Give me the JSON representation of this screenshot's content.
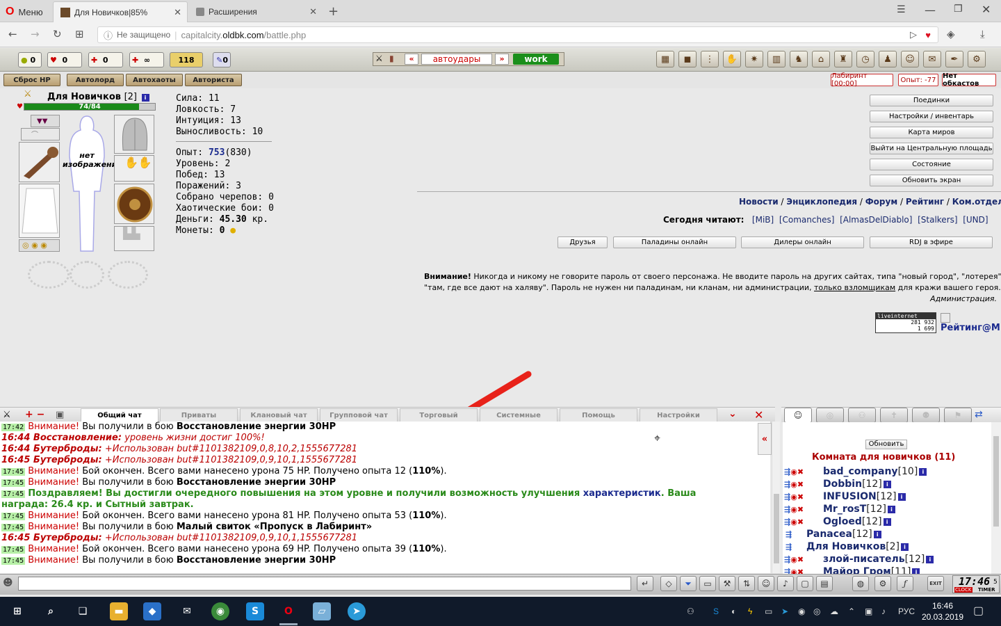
{
  "browser": {
    "menu_label": "Меню",
    "tabs": [
      {
        "title": "Для Новичков|85%"
      },
      {
        "title": "Расширения"
      }
    ],
    "security": "Не защищено",
    "url_prefix": "capitalcity.",
    "url_domain": "oldbk.com",
    "url_path": "/battle.php"
  },
  "topbar": {
    "counters": [
      "0",
      "0",
      "0",
      "∞",
      "118",
      "0"
    ],
    "autohits_label": "автоудары",
    "nav_left": "«",
    "nav_right": "»",
    "work_label": "work",
    "buttons": [
      "Сброс HP",
      "Автолорд",
      "Автохаоты",
      "Авториста"
    ],
    "labyrinth": "Лабиринт [00:00]",
    "exp_box": "Опыт: -77",
    "no_blocks": "Нет обкастов"
  },
  "character": {
    "name": "Для Новичков",
    "level": "[2]",
    "hp": "74/84",
    "hp_fraction": 0.88,
    "no_image": "нет изображения",
    "stats": [
      {
        "label": "Сила:",
        "value": "11"
      },
      {
        "label": "Ловкость:",
        "value": "7"
      },
      {
        "label": "Интуиция:",
        "value": "13"
      },
      {
        "label": "Выносливость:",
        "value": "10"
      }
    ],
    "exp_label": "Опыт:",
    "exp_value": "753",
    "exp_next": "(830)",
    "details": [
      {
        "label": "Уровень:",
        "value": "2"
      },
      {
        "label": "Побед:",
        "value": "13"
      },
      {
        "label": "Поражений:",
        "value": "3"
      },
      {
        "label": "Собрано черепов:",
        "value": "0"
      },
      {
        "label": "Хаотические бои:",
        "value": "0"
      }
    ],
    "money_label": "Деньги:",
    "money_value": "45.30",
    "money_unit": "кр.",
    "coins_label": "Монеты:",
    "coins_value": "0"
  },
  "right_menu": [
    {
      "label": "Поединки",
      "bold": true
    },
    {
      "label": "Настройки / инвентарь",
      "bold": false
    },
    {
      "label": "Карта миров",
      "bold": true
    },
    {
      "label": "Выйти на Центральную площадь",
      "bold": false
    },
    {
      "label": "Состояние",
      "bold": false
    },
    {
      "label": "Обновить экран",
      "bold": false
    }
  ],
  "links": [
    "Новости",
    "Энциклопедия",
    "Форум",
    "Рейтинг",
    "Ком.отдел"
  ],
  "reading": {
    "label": "Сегодня читают:",
    "clans": [
      "[MiB]",
      "[Comanches]",
      "[AlmasDelDiablo]",
      "[Stalkers]",
      "[UND]"
    ]
  },
  "mid_buttons": [
    "Друзья",
    "Паладины онлайн",
    "Дилеры онлайн",
    "RDJ в эфире"
  ],
  "warning": {
    "title": "Внимание!",
    "line1": "Никогда и никому не говорите пароль от своего персонажа. Не вводите пароль на других сайтах, типа \"новый город\", \"лотерея\",",
    "line2a": "\"там, где все дают на халяву\". Пароль не нужен ни паладинам, ни кланам, ни администрации,",
    "line2link": "только взломщикам",
    "line2b": "для кражи вашего героя.",
    "sign": "Администрация."
  },
  "counter": {
    "brand": "liveinternet",
    "n1": "281 932",
    "n2": "1 699",
    "rating_text": "Рейтинг@M"
  },
  "chat": {
    "tabs": [
      "Общий чат",
      "Приваты",
      "Клановый чат",
      "Групповой чат",
      "Торговый",
      "Системные",
      "Помощь",
      "Настройки"
    ],
    "collapse": "«",
    "lines": [
      {
        "ts": "17:42",
        "kind": "warn",
        "a": "Внимание!",
        "b": " Вы получили в бою ",
        "c": "Восстановление энергии 30HP",
        "d": ""
      },
      {
        "ts": "",
        "kind": "itb",
        "a": "16:44 Восстановление:",
        "b": " уровень жизни достиг 100%!",
        "c": "",
        "d": ""
      },
      {
        "ts": "",
        "kind": "itb",
        "a": "16:44 Бутерброды:",
        "b": " +Использован but#1101382109,0,8,10,2,1555677281",
        "c": "",
        "d": ""
      },
      {
        "ts": "",
        "kind": "itb",
        "a": "16:45 Бутерброды:",
        "b": " +Использован but#1101382109,0,9,10,1,1555677281",
        "c": "",
        "d": ""
      },
      {
        "ts": "17:45",
        "kind": "warn",
        "a": "Внимание!",
        "b": " Бой окончен. Всего вами нанесено урона 75 HP. Получено опыта 12 (",
        "c": "110%",
        "d": ")."
      },
      {
        "ts": "17:45",
        "kind": "warn",
        "a": "Внимание!",
        "b": " Вы получили в бою ",
        "c": "Восстановление энергии 30HP",
        "d": ""
      },
      {
        "ts": "17:45",
        "kind": "green",
        "a": "Поздравляем! Вы достигли очередного повышения на этом уровне и получили возможность улучшения",
        "b": " характеристик",
        "c": ". Ваша",
        "d": ""
      },
      {
        "ts": "",
        "kind": "green2",
        "a": "награда: 26.4 кр. и Сытный завтрак.",
        "b": "",
        "c": "",
        "d": ""
      },
      {
        "ts": "17:45",
        "kind": "warn",
        "a": "Внимание!",
        "b": " Бой окончен. Всего вами нанесено урона 81 HP. Получено опыта 53 (",
        "c": "110%",
        "d": ")."
      },
      {
        "ts": "17:45",
        "kind": "warn",
        "a": "Внимание!",
        "b": " Вы получили в бою ",
        "c": "Малый свиток «Пропуск в Лабиринт»",
        "d": ""
      },
      {
        "ts": "",
        "kind": "itb",
        "a": "16:45 Бутерброды:",
        "b": " +Использован but#1101382109,0,9,10,1,1555677281",
        "c": "",
        "d": ""
      },
      {
        "ts": "17:45",
        "kind": "warn",
        "a": "Внимание!",
        "b": " Бой окончен. Всего вами нанесено урона 69 HP. Получено опыта 39 (",
        "c": "110%",
        "d": ")."
      },
      {
        "ts": "17:45",
        "kind": "warn",
        "a": "Внимание!",
        "b": " Вы получили в бою ",
        "c": "Восстановление энергии 30HP",
        "d": ""
      }
    ]
  },
  "users_panel": {
    "refresh": "Обновить",
    "room": "Комната для новичков (11)",
    "users": [
      {
        "name": "bad_company",
        "level": "[10]"
      },
      {
        "name": "Dobbin",
        "level": "[12]"
      },
      {
        "name": "INFUSION",
        "level": "[12]"
      },
      {
        "name": "Mr_rosT",
        "level": "[12]"
      },
      {
        "name": "Ogloed",
        "level": "[12]"
      },
      {
        "name": "Panacea",
        "level": "[12]"
      },
      {
        "name": "Для Новичков",
        "level": "[2]"
      },
      {
        "name": "злой-писатель",
        "level": "[12]"
      },
      {
        "name": "Майор Гром",
        "level": "[11]"
      }
    ]
  },
  "clock": {
    "time": "17:46",
    "sec": "5",
    "label1": "CLOCK",
    "label2": "TIMER",
    "exit": "EXIT"
  },
  "taskbar": {
    "lang": "РУС",
    "time": "16:46",
    "date": "20.03.2019"
  }
}
